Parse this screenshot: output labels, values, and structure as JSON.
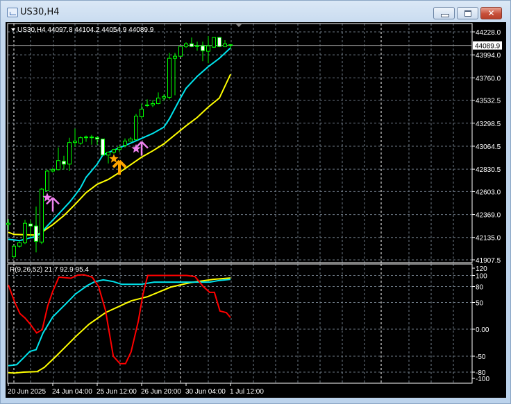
{
  "window": {
    "title": "US30,H4",
    "close_glyph": "✕"
  },
  "colors": {
    "bull": "#00ff00",
    "bear_fill": "#ffffff",
    "ma_fast": "#00e5ee",
    "ma_slow": "#ffff00",
    "ind_red": "#ff0000",
    "signal_pink": "#ee82ee",
    "signal_orange": "#ffa500",
    "grid": "#6e7a86"
  },
  "main_pane": {
    "legend": "US30,H4  44097.8 44104.2 44054.9 44089.9",
    "current_price_label": "44089.9",
    "current_price": 44089.9,
    "price_ticks": [
      "44228.0",
      "43994.0",
      "43760.0",
      "43532.5",
      "43298.5",
      "43064.5",
      "42830.5",
      "42603.0",
      "42369.0",
      "42135.0",
      "41907.5"
    ],
    "price_range": [
      41907.5,
      44228.0
    ]
  },
  "indicator_pane": {
    "legend": "R(9,26,52) 21.7 92.9 95.4",
    "ticks": [
      {
        "label": "120",
        "v": 120
      },
      {
        "label": "100",
        "v": 100
      },
      {
        "label": "80",
        "v": 80
      },
      {
        "label": "50",
        "v": 50
      },
      {
        "label": "0.00",
        "v": 0
      },
      {
        "label": "-50",
        "v": -50
      },
      {
        "label": "-80",
        "v": -80
      },
      {
        "label": "-100",
        "v": -100
      }
    ]
  },
  "time_axis": {
    "labels": [
      "20 Jun 2025",
      "24 Jun 04:00",
      "25 Jun 12:00",
      "26 Jun 20:00",
      "30 Jun 04:00",
      "1 Jul 12:00"
    ],
    "label_candle_index": [
      0,
      8,
      16,
      24,
      32,
      40
    ]
  },
  "chart_data": {
    "type": "candlestick",
    "symbol": "US30",
    "timeframe": "H4",
    "ohlc": [
      [
        42266,
        42323,
        42210,
        42280
      ],
      [
        41940,
        42054,
        41926,
        42047
      ],
      [
        42047,
        42096,
        42032,
        42082
      ],
      [
        42082,
        42316,
        42068,
        42280
      ],
      [
        42273,
        42309,
        42138,
        42252
      ],
      [
        42252,
        42450,
        41983,
        42096
      ],
      [
        42089,
        42641,
        42068,
        42627
      ],
      [
        42613,
        42826,
        42606,
        42811
      ],
      [
        42811,
        42847,
        42797,
        42826
      ],
      [
        42826,
        43052,
        42818,
        42918
      ],
      [
        42911,
        42967,
        42826,
        42882
      ],
      [
        42882,
        43151,
        42811,
        43102
      ],
      [
        43102,
        43243,
        43059,
        43116
      ],
      [
        43095,
        43165,
        43080,
        43151
      ],
      [
        43151,
        43173,
        43109,
        43158
      ],
      [
        43151,
        43180,
        43080,
        43158
      ],
      [
        43151,
        43165,
        43080,
        43137
      ],
      [
        43137,
        43137,
        42974,
        42974
      ],
      [
        42974,
        43010,
        42889,
        43003
      ],
      [
        43003,
        43038,
        42988,
        43031
      ],
      [
        43031,
        43074,
        43003,
        43052
      ],
      [
        43074,
        43144,
        43052,
        43116
      ],
      [
        43116,
        43158,
        43109,
        43137
      ],
      [
        43130,
        43392,
        43130,
        43371
      ],
      [
        43364,
        43498,
        43343,
        43442
      ],
      [
        43477,
        43541,
        43463,
        43484
      ],
      [
        43484,
        43534,
        43463,
        43498
      ],
      [
        43498,
        43612,
        43491,
        43555
      ],
      [
        43555,
        43591,
        43527,
        43569
      ],
      [
        43562,
        44015,
        43541,
        43959
      ],
      [
        43959,
        44015,
        43583,
        43980
      ],
      [
        43980,
        44086,
        43973,
        44079
      ],
      [
        44079,
        44122,
        44065,
        44107
      ],
      [
        44107,
        44171,
        44072,
        44079
      ],
      [
        44079,
        44129,
        44037,
        44086
      ],
      [
        44086,
        44129,
        43930,
        44037
      ],
      [
        44030,
        44185,
        43909,
        44086
      ],
      [
        44072,
        44171,
        44065,
        44171
      ],
      [
        44171,
        44178,
        44072,
        44079
      ],
      [
        44079,
        44143,
        44072,
        44107
      ],
      [
        44097.8,
        44104.2,
        44054.9,
        44089.9
      ]
    ],
    "ma_fast": [
      [
        0,
        42117
      ],
      [
        2,
        42103
      ],
      [
        5,
        42146
      ],
      [
        6,
        42188
      ],
      [
        7,
        42252
      ],
      [
        9,
        42372
      ],
      [
        11,
        42493
      ],
      [
        12,
        42564
      ],
      [
        13,
        42641
      ],
      [
        14,
        42748
      ],
      [
        16,
        42882
      ],
      [
        17,
        42974
      ],
      [
        19,
        43024
      ],
      [
        22,
        43095
      ],
      [
        24,
        43144
      ],
      [
        26,
        43194
      ],
      [
        28,
        43258
      ],
      [
        29,
        43343
      ],
      [
        31,
        43555
      ],
      [
        32,
        43654
      ],
      [
        34,
        43775
      ],
      [
        36,
        43874
      ],
      [
        38,
        43959
      ],
      [
        40,
        44065
      ]
    ],
    "ma_slow": [
      [
        0,
        42188
      ],
      [
        1,
        42167
      ],
      [
        5,
        42160
      ],
      [
        6,
        42188
      ],
      [
        8,
        42266
      ],
      [
        10,
        42358
      ],
      [
        12,
        42471
      ],
      [
        14,
        42592
      ],
      [
        16,
        42677
      ],
      [
        18,
        42726
      ],
      [
        20,
        42797
      ],
      [
        22,
        42875
      ],
      [
        24,
        42953
      ],
      [
        26,
        43017
      ],
      [
        28,
        43088
      ],
      [
        30,
        43180
      ],
      [
        32,
        43272
      ],
      [
        34,
        43357
      ],
      [
        36,
        43463
      ],
      [
        38,
        43555
      ],
      [
        40,
        43796
      ]
    ],
    "signals": [
      {
        "type": "star",
        "color": "pink",
        "index": 7,
        "price": 42542
      },
      {
        "type": "arrow-up",
        "color": "pink",
        "index": 8,
        "price": 42540
      },
      {
        "type": "star",
        "color": "orange",
        "index": 19,
        "price": 42936
      },
      {
        "type": "arrow-up",
        "color": "orange",
        "index": 20,
        "price": 42915
      },
      {
        "type": "star",
        "color": "pink",
        "index": 23,
        "price": 43038
      },
      {
        "type": "arrow-up",
        "color": "pink",
        "index": 24,
        "price": 43109
      }
    ],
    "indicator": {
      "name": "R(9,26,52)",
      "ylim": [
        -100,
        120
      ],
      "series": [
        {
          "name": "R9",
          "color": "red",
          "points": [
            [
              0,
              83
            ],
            [
              1.25,
              48
            ],
            [
              2.1,
              29
            ],
            [
              3,
              21
            ],
            [
              3.9,
              10
            ],
            [
              5.1,
              -7
            ],
            [
              6.1,
              -1
            ],
            [
              7.1,
              44
            ],
            [
              8,
              71
            ],
            [
              9.1,
              97
            ],
            [
              11.25,
              95
            ],
            [
              12.5,
              101
            ],
            [
              13.6,
              102
            ],
            [
              15.1,
              97
            ],
            [
              16.25,
              80
            ],
            [
              17.5,
              35
            ],
            [
              18.9,
              -50
            ],
            [
              20.1,
              -64
            ],
            [
              21.1,
              -64
            ],
            [
              22.1,
              -42
            ],
            [
              23.4,
              15
            ],
            [
              24.25,
              66
            ],
            [
              25.1,
              100
            ],
            [
              32.1,
              100
            ],
            [
              33.6,
              98
            ],
            [
              35.1,
              80
            ],
            [
              36.25,
              69
            ],
            [
              37.1,
              69
            ],
            [
              38.1,
              34
            ],
            [
              39.25,
              31
            ],
            [
              40,
              21.7
            ]
          ]
        },
        {
          "name": "R26",
          "color": "cyan",
          "points": [
            [
              0,
              -68
            ],
            [
              1.5,
              -66
            ],
            [
              2.75,
              -53
            ],
            [
              3.9,
              -41
            ],
            [
              5,
              -38
            ],
            [
              6.25,
              -7
            ],
            [
              8,
              23
            ],
            [
              10.4,
              48
            ],
            [
              12.1,
              66
            ],
            [
              14.25,
              82
            ],
            [
              15.6,
              89
            ],
            [
              17.1,
              92
            ],
            [
              18.9,
              89
            ],
            [
              20.4,
              84
            ],
            [
              23.9,
              84
            ],
            [
              26.25,
              88
            ],
            [
              36.25,
              88
            ],
            [
              38,
              91
            ],
            [
              40,
              92.9
            ]
          ]
        },
        {
          "name": "R52",
          "color": "yellow",
          "points": [
            [
              0,
              -82
            ],
            [
              1.1,
              -83
            ],
            [
              2.75,
              -80
            ],
            [
              5.2,
              -79
            ],
            [
              6.5,
              -71
            ],
            [
              8.6,
              -50
            ],
            [
              12.1,
              -14
            ],
            [
              14.5,
              9
            ],
            [
              17.5,
              31
            ],
            [
              22.1,
              53
            ],
            [
              25.1,
              61
            ],
            [
              29.25,
              79
            ],
            [
              32.75,
              87
            ],
            [
              36.9,
              93
            ],
            [
              40,
              95.4
            ]
          ]
        }
      ]
    }
  }
}
